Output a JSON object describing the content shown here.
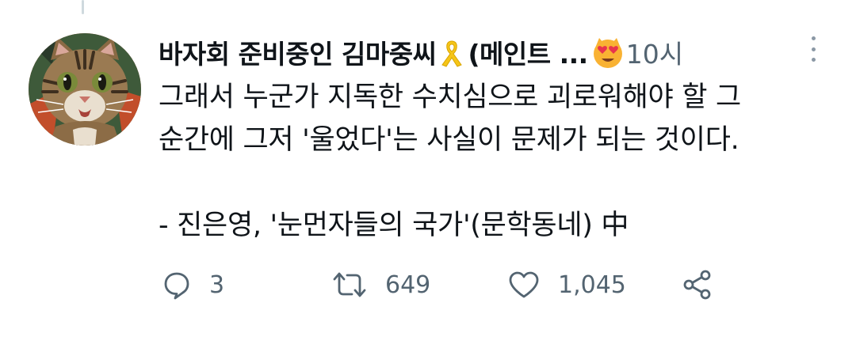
{
  "tweet": {
    "author": {
      "name_main": "바자회 준비중인 김마중씨",
      "name_tail": "(메인트 ...",
      "name_emoji_icons": [
        "yellow-ribbon-icon",
        "heart-eyes-emoji-icon"
      ]
    },
    "timestamp": "10시",
    "text_lines": [
      "그래서 누군가 지독한 수치심으로 괴로워해야 할 그",
      "순간에 그저 '울었다'는 사실이 문제가 되는 것이다.",
      "",
      "- 진은영, '눈먼자들의 국가'(문학동네) 中"
    ]
  },
  "actions": {
    "reply": {
      "icon": "reply-icon",
      "count": "3"
    },
    "retweet": {
      "icon": "retweet-icon",
      "count": "649"
    },
    "like": {
      "icon": "like-icon",
      "count": "1,045"
    },
    "share": {
      "icon": "share-icon"
    }
  },
  "colors": {
    "text": "#0f1419",
    "secondary": "#536471",
    "ribbon": "#f5c518",
    "emoji_face": "#f9b233",
    "emoji_heart": "#e8344d"
  }
}
